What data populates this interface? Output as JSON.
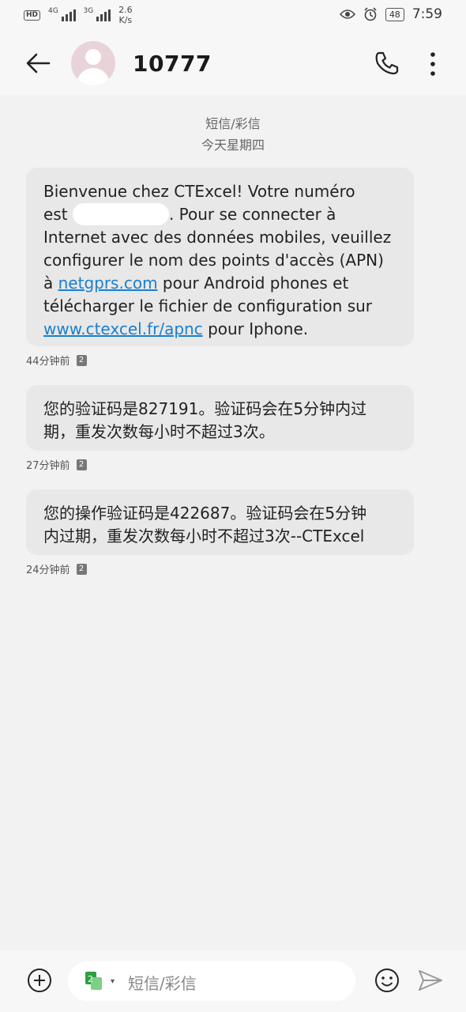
{
  "status_bar": {
    "hd": "HD",
    "net1": "4G",
    "net2": "3G",
    "speed_value": "2.6",
    "speed_unit": "K/s",
    "battery": "48",
    "time": "7:59"
  },
  "header": {
    "contact": "10777"
  },
  "conversation": {
    "type_label": "短信/彩信",
    "date_label": "今天星期四",
    "messages": [
      {
        "line1": "Bienvenue chez CTExcel! Votre numéro",
        "est": "est",
        "line2_rest": ". Pour se connecter à",
        "line3": "Internet avec des données mobiles, veuillez",
        "line4": "configurer le nom des points d'accès (APN)",
        "a_prefix": "à",
        "link1": "netgprs.com",
        "line5_rest": "pour Android phones et",
        "line6": "télécharger le fichier de configuration sur",
        "link2": "www.ctexcel.fr/apnc",
        "line7_rest": "pour Iphone.",
        "time": "44分钟前",
        "sim": "2"
      },
      {
        "line1": "您的验证码是827191。验证码会在5分钟内过",
        "line2": "期，重发次数每小时不超过3次。",
        "time": "27分钟前",
        "sim": "2"
      },
      {
        "line1": "您的操作验证码是422687。验证码会在5分钟",
        "line2": "内过期，重发次数每小时不超过3次--CTExcel",
        "time": "24分钟前",
        "sim": "2"
      }
    ]
  },
  "composer": {
    "placeholder": "短信/彩信",
    "sim_label": "2"
  }
}
